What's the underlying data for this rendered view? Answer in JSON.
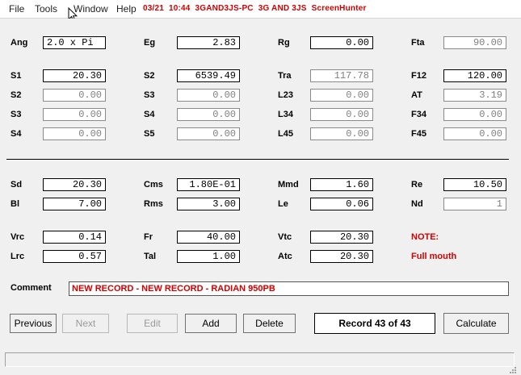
{
  "menu": {
    "file": "File",
    "tools": "Tools",
    "window": "Window",
    "help": "Help"
  },
  "banner": "03/21  10:44  3GAND3JS-PC  3G AND 3JS  ScreenHunter",
  "fields": {
    "ang": {
      "label": "Ang",
      "value": "2.0 x Pi"
    },
    "eg": {
      "label": "Eg",
      "value": "2.83"
    },
    "rg": {
      "label": "Rg",
      "value": "0.00"
    },
    "fta": {
      "label": "Fta",
      "value": "90.00"
    },
    "s1": {
      "label": "S1",
      "value": "20.30"
    },
    "s2b": {
      "label": "S2",
      "value": "6539.49"
    },
    "tra": {
      "label": "Tra",
      "value": "117.78"
    },
    "f12": {
      "label": "F12",
      "value": "120.00"
    },
    "s2": {
      "label": "S2",
      "value": "0.00"
    },
    "s3b": {
      "label": "S3",
      "value": "0.00"
    },
    "l23": {
      "label": "L23",
      "value": "0.00"
    },
    "at": {
      "label": "AT",
      "value": "3.19"
    },
    "s3": {
      "label": "S3",
      "value": "0.00"
    },
    "s4b": {
      "label": "S4",
      "value": "0.00"
    },
    "l34": {
      "label": "L34",
      "value": "0.00"
    },
    "f34": {
      "label": "F34",
      "value": "0.00"
    },
    "s4": {
      "label": "S4",
      "value": "0.00"
    },
    "s5": {
      "label": "S5",
      "value": "0.00"
    },
    "l45": {
      "label": "L45",
      "value": "0.00"
    },
    "f45": {
      "label": "F45",
      "value": "0.00"
    },
    "sd": {
      "label": "Sd",
      "value": "20.30"
    },
    "cms": {
      "label": "Cms",
      "value": "1.80E-01"
    },
    "mmd": {
      "label": "Mmd",
      "value": "1.60"
    },
    "re": {
      "label": "Re",
      "value": "10.50"
    },
    "bl": {
      "label": "Bl",
      "value": "7.00"
    },
    "rms": {
      "label": "Rms",
      "value": "3.00"
    },
    "le": {
      "label": "Le",
      "value": "0.06"
    },
    "nd": {
      "label": "Nd",
      "value": "1"
    },
    "vrc": {
      "label": "Vrc",
      "value": "0.14"
    },
    "fr": {
      "label": "Fr",
      "value": "40.00"
    },
    "vtc": {
      "label": "Vtc",
      "value": "20.30"
    },
    "lrc": {
      "label": "Lrc",
      "value": "0.57"
    },
    "tal": {
      "label": "Tal",
      "value": "1.00"
    },
    "atc": {
      "label": "Atc",
      "value": "20.30"
    }
  },
  "note": {
    "label": "NOTE:",
    "text": "Full mouth"
  },
  "comment": {
    "label": "Comment",
    "value": "NEW RECORD - NEW RECORD - RADIAN 950PB"
  },
  "buttons": {
    "previous": "Previous",
    "next": "Next",
    "edit": "Edit",
    "add": "Add",
    "delete": "Delete",
    "calculate": "Calculate"
  },
  "record": "Record 43 of 43",
  "colors": {
    "accent_red": "#d40000",
    "disabled_text": "#808080",
    "background": "#f0f0f0"
  },
  "icons": {
    "cursor": "arrow-cursor-icon",
    "grip": "resize-grip-icon"
  }
}
